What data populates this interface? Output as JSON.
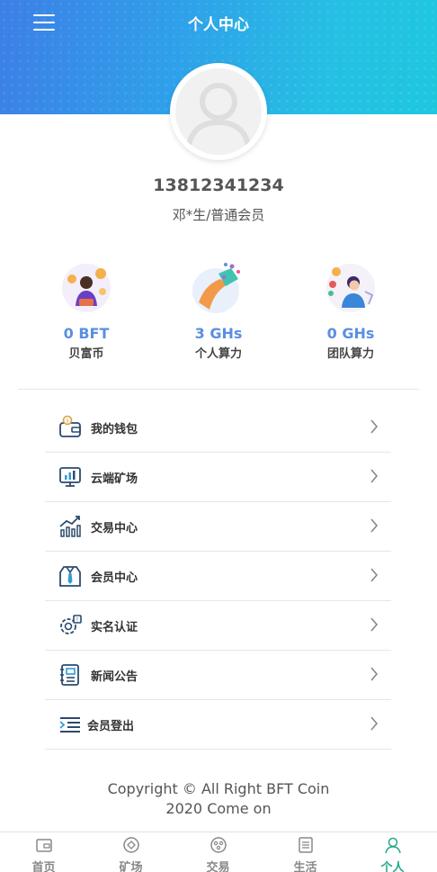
{
  "header": {
    "title": "个人中心",
    "menu_icon": "hamburger-menu-icon"
  },
  "profile": {
    "avatar_icon": "default-user-avatar",
    "phone": "13812341234",
    "level": "邓*生/普通会员"
  },
  "stats": [
    {
      "value": "0 BFT",
      "label": "贝富币",
      "icon": "coin-wallet-illustration"
    },
    {
      "value": "3 GHs",
      "label": "个人算力",
      "icon": "personal-hashrate-illustration"
    },
    {
      "value": "0 GHs",
      "label": "团队算力",
      "icon": "team-hashrate-illustration"
    }
  ],
  "menu": [
    {
      "label": "我的钱包",
      "icon": "wallet-icon"
    },
    {
      "label": "云端矿场",
      "icon": "cloud-mining-icon"
    },
    {
      "label": "交易中心",
      "icon": "trade-chart-icon"
    },
    {
      "label": "会员中心",
      "icon": "member-icon"
    },
    {
      "label": "实名认证",
      "icon": "verify-icon"
    },
    {
      "label": "新闻公告",
      "icon": "news-icon"
    },
    {
      "label": "会员登出",
      "icon": "logout-icon"
    }
  ],
  "copyright": {
    "line1": "Copyright © All Right BFT Coin",
    "line2": "2020 Come on"
  },
  "tabbar": {
    "active": "个人",
    "items": [
      {
        "label": "首页",
        "icon": "home-icon"
      },
      {
        "label": "矿场",
        "icon": "mine-icon"
      },
      {
        "label": "交易",
        "icon": "exchange-icon"
      },
      {
        "label": "生活",
        "icon": "life-icon"
      },
      {
        "label": "个人",
        "icon": "person-icon"
      }
    ]
  },
  "colors": {
    "accent": "#22a98a",
    "stat_value": "#5a8fe0",
    "header_start": "#3d7fe6",
    "header_end": "#1fc7de"
  }
}
